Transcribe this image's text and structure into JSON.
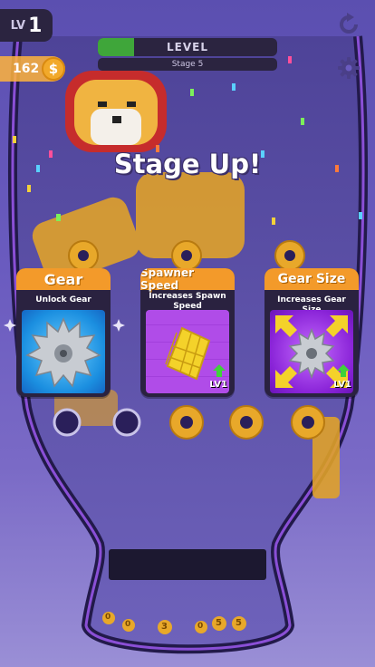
{
  "hud": {
    "lv_prefix": "LV",
    "lv_value": "1",
    "coins": "162",
    "coin_symbol": "$",
    "level_label": "LEVEL",
    "level_progress": 0.2,
    "stage_label": "Stage 5"
  },
  "popup": {
    "title": "Stage Up!"
  },
  "cards": [
    {
      "title": "Gear",
      "desc": "Unlock Gear",
      "level": ""
    },
    {
      "title": "Spawner Speed",
      "desc": "Increases Spawn Speed",
      "level": "LV1"
    },
    {
      "title": "Gear Size",
      "desc": "Increases Gear Size",
      "level": "LV1"
    }
  ],
  "tray_coins": [
    "0",
    "0",
    "3",
    "0",
    "5",
    "5"
  ],
  "colors": {
    "accent": "#f39a2a",
    "progress": "#3fa63a",
    "card_bg": "#2a2240",
    "machine_outline": "#2a1f5a"
  },
  "icons": {
    "restart": "restart-icon",
    "settings": "gear-icon",
    "coin": "coin-icon"
  }
}
